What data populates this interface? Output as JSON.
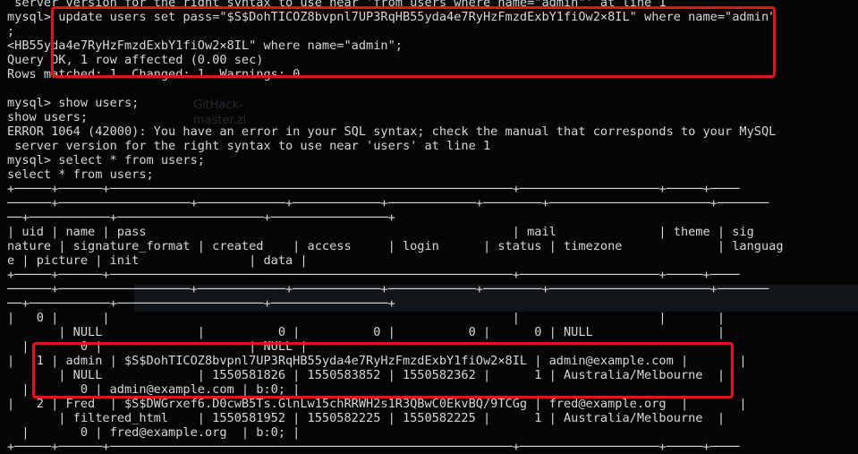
{
  "background_overlay": {
    "ghost_labels": [
      "GitHack-",
      "master.zi"
    ],
    "accent_color": "#e0161b"
  },
  "terminal": {
    "lines": [
      " server version for the right syntax to use near 'from users where name=\"admin\"' at line 1",
      "mysql> update users set pass=\"$S$DohTICOZ8bvpnl7UP3RqHB55yda4e7RyHzFmzdExbY1fiOw2×8IL\" where name=\"admin\"",
      ";",
      "<HB55yda4e7RyHzFmzdExbY1fiOw2×8IL\" where name=\"admin\";",
      "Query OK, 1 row affected (0.00 sec)",
      "Rows matched: 1  Changed: 1  Warnings: 0",
      "",
      "mysql> show users;",
      "show users;",
      "ERROR 1064 (42000): You have an error in your SQL syntax; check the manual that corresponds to your MySQL",
      " server version for the right syntax to use near 'users' at line 1",
      "mysql> select * from users;",
      "select * from users;",
      "+─────+──────+───────────────────────────────────────────────────────+───────────────────+─────+────",
      "──────+──────────────────+────────────+────────────+────────────+────────+──────────────────────+───────",
      "──+───────────+────────────────────+────────────────+",
      "| uid | name | pass                                                  | mail              | theme | sig",
      "nature | signature_format | created    | access     | login      | status | timezone             | languag",
      "e | picture | init               | data |",
      "+─────+──────+───────────────────────────────────────────────────────+───────────────────+─────+────",
      "──────+──────────────────+────────────+────────────+────────────+────────+──────────────────────+───────",
      "──+───────────+────────────────────+────────────────+",
      "|   0 |      |                                                       |                   |       |",
      "       | NULL             |          0 |          0 |          0 |      0 | NULL                 |",
      "  |       0 |                    | NULL |",
      "|   1 | admin | $S$DohTICOZ8bvpnl7UP3RqHB55yda4e7RyHzFmzdExbY1fiOw2×8IL | admin@example.com |       |",
      "       | NULL             | 1550581826 | 1550583852 | 1550582362 |      1 | Australia/Melbourne  |",
      "  |       0 | admin@example.com | b:0; |",
      "|   2 | Fred  | $S$DWGrxef6.D0cwB5Ts.GlnLw15chRRWH2s1R3QBwC0EkvBQ/9TCGg | fred@example.org  |       |",
      "       | filtered_html    | 1550581952 | 1550582225 | 1550582225 |      1 | Australia/Melbourne  |",
      "  |       0 | fred@example.org  | b:0; |",
      "+─────+──────+───────────────────────────────────────────────────────+───────────────────+─────+────"
    ]
  }
}
